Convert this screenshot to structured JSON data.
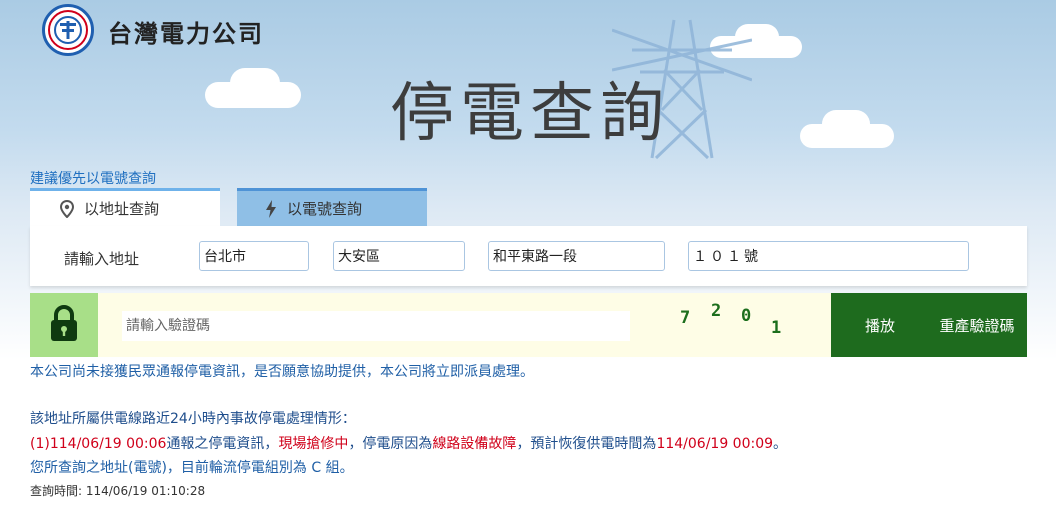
{
  "header": {
    "company_name": "台灣電力公司",
    "page_title": "停電查詢"
  },
  "suggest_link": "建議優先以電號查詢",
  "tabs": [
    {
      "label": "以地址查詢",
      "icon": "map-pin-icon",
      "active": true
    },
    {
      "label": "以電號查詢",
      "icon": "lightning-icon",
      "active": false
    }
  ],
  "address_form": {
    "label": "請輸入地址",
    "city": "台北市",
    "district": "大安區",
    "road": "和平東路一段",
    "number": "１０１號"
  },
  "captcha": {
    "placeholder": "請輸入驗證碼",
    "digits": [
      "7",
      "2",
      "0",
      "1"
    ],
    "play_label": "播放",
    "refresh_label": "重產驗證碼",
    "icon": "lock-icon"
  },
  "notice": "本公司尚未接獲民眾通報停電資訊，是否願意協助提供，本公司將立即派員處理。",
  "result": {
    "section_title": "該地址所屬供電線路近24小時內事故停電處理情形：",
    "record": {
      "index": "(1)",
      "report_time": "114/06/19 00:06",
      "text_1": "通報之停電資訊，",
      "status": "現場搶修中",
      "text_2": "，停電原因為",
      "cause": "線路設備故障",
      "text_3": "，預計恢復供電時間為",
      "restore_time": "114/06/19 00:09",
      "text_4": "。"
    },
    "rotation_text": "您所查詢之地址(電號)，目前輪流停電組別為 C 組。",
    "query_time": "查詢時間: 114/06/19 01:10:28"
  },
  "colors": {
    "accent_blue": "#1f6fc0",
    "alert_red": "#d0001a",
    "captcha_green": "#1e6b1e",
    "lock_green": "#a8df88"
  }
}
